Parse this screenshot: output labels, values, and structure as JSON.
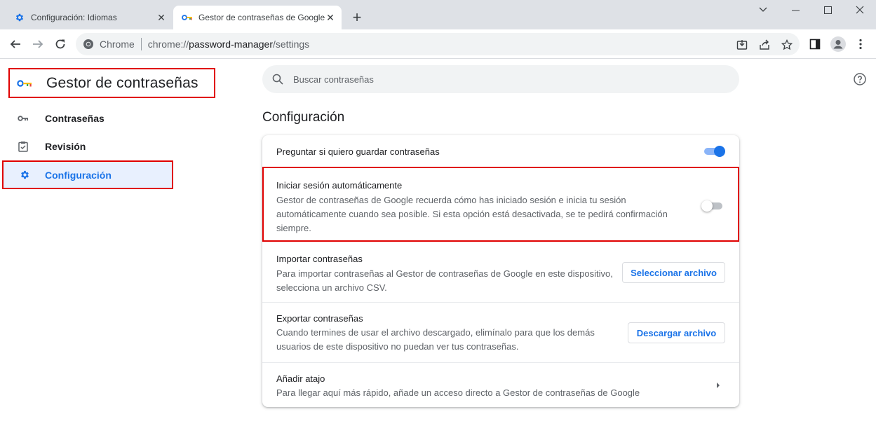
{
  "browser": {
    "tabs": [
      {
        "title": "Configuración: Idiomas",
        "icon": "gear-icon"
      },
      {
        "title": "Gestor de contraseñas de Google",
        "icon": "key-icon"
      }
    ],
    "address": {
      "chip_label": "Chrome",
      "url_scheme": "chrome://",
      "url_host": "password-manager",
      "url_path": "/settings"
    }
  },
  "sidebar": {
    "title": "Gestor de contraseñas",
    "items": [
      {
        "label": "Contraseñas",
        "icon": "key-icon"
      },
      {
        "label": "Revisión",
        "icon": "clipboard-check-icon"
      },
      {
        "label": "Configuración",
        "icon": "gear-icon",
        "active": true
      }
    ]
  },
  "search": {
    "placeholder": "Buscar contraseñas"
  },
  "main": {
    "section_title": "Configuración",
    "settings": [
      {
        "title": "Preguntar si quiero guardar contraseñas",
        "toggle": true
      },
      {
        "title": "Iniciar sesión automáticamente",
        "desc_lines": [
          "Gestor de contraseñas de Google recuerda cómo has iniciado sesión e inicia tu sesión",
          "automáticamente cuando sea posible. Si esta opción está desactivada, se te pedirá confirmación",
          "siempre."
        ],
        "toggle": false
      },
      {
        "title": "Importar contraseñas",
        "desc_lines": [
          "Para importar contraseñas al Gestor de contraseñas de Google en este dispositivo,",
          "selecciona un archivo CSV."
        ],
        "button": "Seleccionar archivo"
      },
      {
        "title": "Exportar contraseñas",
        "desc_lines": [
          "Cuando termines de usar el archivo descargado, elimínalo para que los demás",
          "usuarios de este dispositivo no puedan ver tus contraseñas."
        ],
        "button": "Descargar archivo"
      },
      {
        "title": "Añadir atajo",
        "desc_lines": [
          "Para llegar aquí más rápido, añade un acceso directo a Gestor de contraseñas de Google"
        ]
      }
    ]
  },
  "colors": {
    "accent": "#1a73e8",
    "highlight": "#e00000",
    "tabstrip": "#dee1e6"
  }
}
